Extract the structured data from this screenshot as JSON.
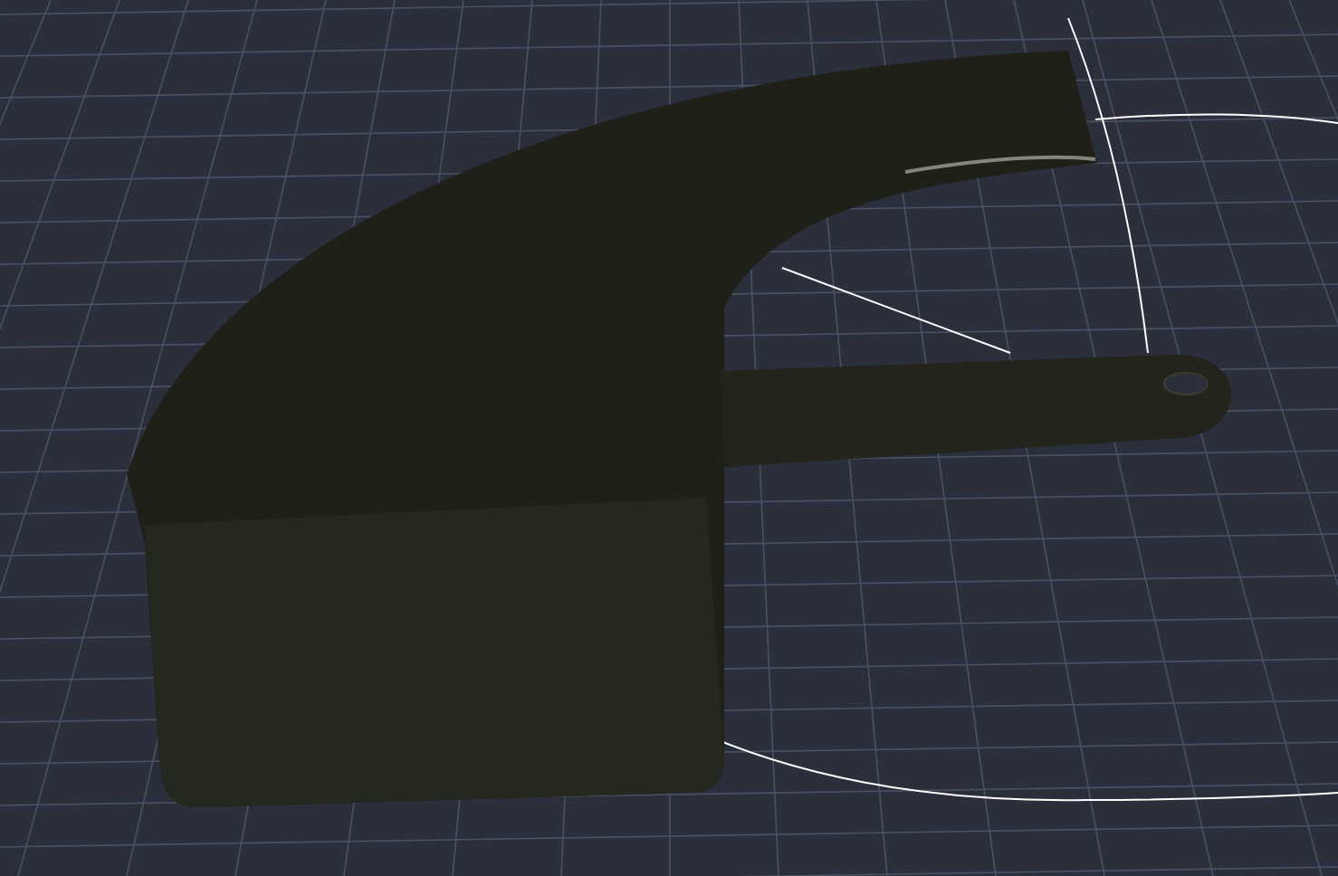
{
  "scene": {
    "kind": "model"
  }
}
